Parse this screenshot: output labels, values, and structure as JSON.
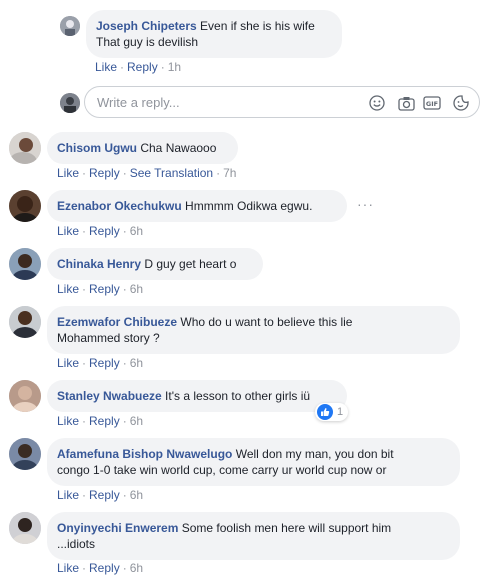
{
  "actions": {
    "like": "Like",
    "reply": "Reply",
    "see_translation": "See Translation",
    "separator": "·"
  },
  "reply_box": {
    "placeholder": "Write a reply..."
  },
  "icons": [
    "emoji-icon",
    "camera-icon",
    "gif-icon",
    "sticker-icon",
    "like-reaction-icon",
    "more-options-icon"
  ],
  "colors": {
    "author": "#385898",
    "bubble": "#f2f3f5",
    "meta": "#90949c",
    "like_badge": "#2078f4"
  },
  "comments": [
    {
      "author": "Joseph Chipeters",
      "text_line1": "Even if she is his wife",
      "text_line2": "That guy is devilish",
      "time": "1h"
    },
    {
      "author": "Chisom Ugwu",
      "text": "Cha Nawaooo",
      "time": "7h"
    },
    {
      "author": "Ezenabor Okechukwu",
      "text": "Hmmmm Odikwa egwu.",
      "time": "6h"
    },
    {
      "author": "Chinaka Henry",
      "text": "D guy get heart o",
      "time": "6h"
    },
    {
      "author": "Ezemwafor Chibueze",
      "text_line1": "Who do u want to believe this lie",
      "text_line2": "Mohammed story ?",
      "time": "6h"
    },
    {
      "author": "Stanley Nwabueze",
      "text": "It's a lesson to other girls iü",
      "time": "6h",
      "reactions": "1"
    },
    {
      "author": "Afamefuna Bishop Nwawelugo",
      "text_line1": "Well don my man, you don bit",
      "text_line2": "congo 1-0 take win world cup, come carry ur world cup now or",
      "time": "6h"
    },
    {
      "author": "Onyinyechi Enwerem",
      "text_line1": "Some foolish men here will support him",
      "text_line2": "...idiots",
      "time": "6h"
    }
  ]
}
